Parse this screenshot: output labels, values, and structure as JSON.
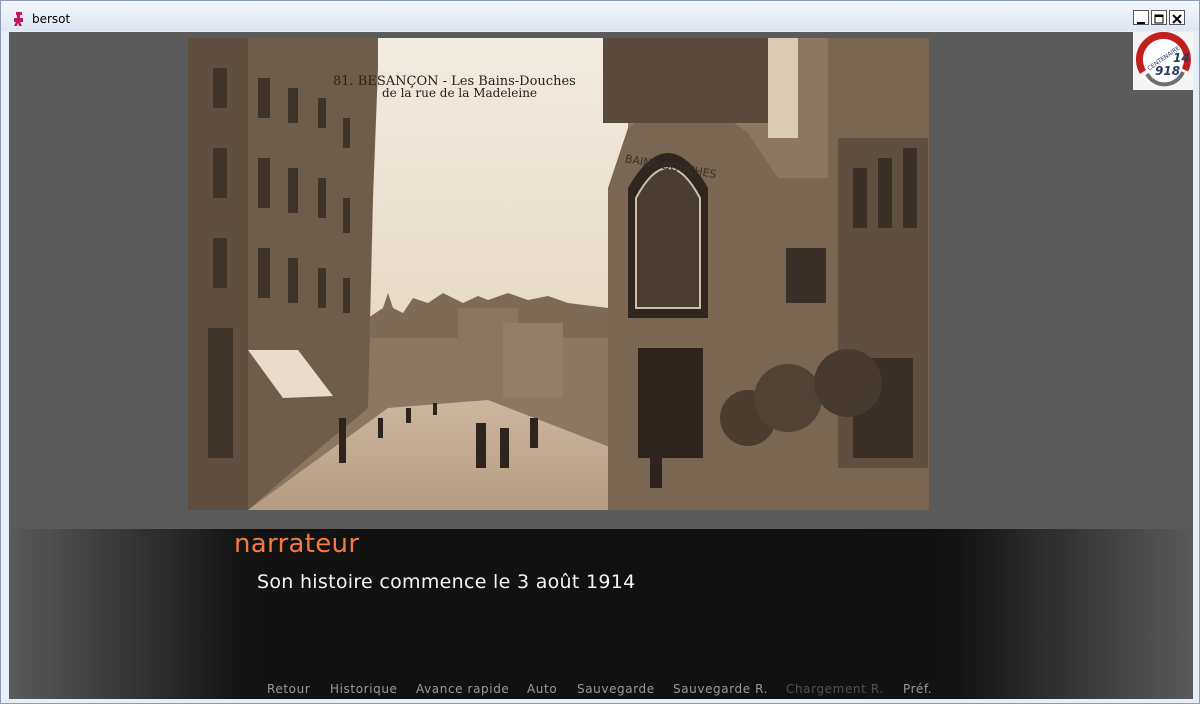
{
  "window": {
    "title": "bersot"
  },
  "postcard": {
    "caption_line1": "81. BESANÇON - Les Bains-Douches",
    "caption_line2": "de la rue de la Madeleine",
    "facade_sign": "BAINS-DOUCHES"
  },
  "badge": {
    "text_arc": "CENTENAIRE",
    "years": "14",
    "years2": "918"
  },
  "dialogue": {
    "speaker": "narrateur",
    "text": "Son histoire commence le 3 août 1914"
  },
  "quick_menu": [
    {
      "label": "Retour",
      "enabled": true
    },
    {
      "label": "Historique",
      "enabled": true
    },
    {
      "label": "Avance rapide",
      "enabled": true
    },
    {
      "label": "Auto",
      "enabled": true
    },
    {
      "label": "Sauvegarde",
      "enabled": true
    },
    {
      "label": "Sauvegarde R.",
      "enabled": true
    },
    {
      "label": "Chargement R.",
      "enabled": false
    },
    {
      "label": "Préf.",
      "enabled": true
    }
  ],
  "colors": {
    "speaker": "#f27a3e",
    "text": "#f4f4f4",
    "menu": "#9a9a9a",
    "menu_disabled": "#525252"
  }
}
